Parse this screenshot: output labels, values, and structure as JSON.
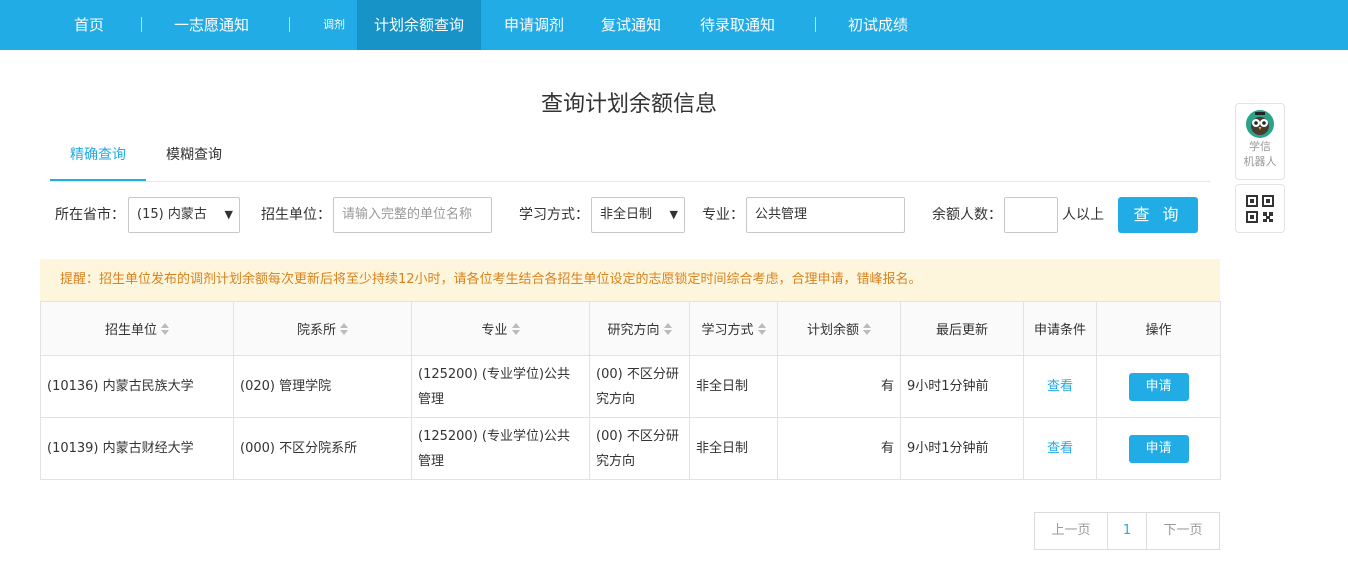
{
  "nav": {
    "items": [
      {
        "label": "首页"
      },
      {
        "label": "一志愿通知"
      },
      {
        "label": "调剂"
      },
      {
        "label": "计划余额查询"
      },
      {
        "label": "申请调剂"
      },
      {
        "label": "复试通知"
      },
      {
        "label": "待录取通知"
      },
      {
        "label": "初试成绩"
      }
    ],
    "active_color": "#1893c7",
    "bar_color": "#22ace5"
  },
  "page_title": "查询计划余额信息",
  "tabs": [
    {
      "label": "精确查询"
    },
    {
      "label": "模糊查询"
    }
  ],
  "filters": {
    "province_label": "所在省市：",
    "province_value": "(15) 内蒙古",
    "unit_label": "招生单位：",
    "unit_placeholder": "请输入完整的单位名称",
    "mode_label": "学习方式：",
    "mode_value": "非全日制",
    "major_label": "专业：",
    "major_value": "公共管理",
    "remain_label": "余额人数：",
    "remain_value": "",
    "remain_suffix": "人以上",
    "query_button": "查 询"
  },
  "notice": "提醒：招生单位发布的调剂计划余额每次更新后将至少持续12小时，请各位考生结合各招生单位设定的志愿锁定时间综合考虑，合理申请，错峰报名。",
  "table": {
    "headers": [
      "招生单位",
      "院系所",
      "专业",
      "研究方向",
      "学习方式",
      "计划余额",
      "最后更新",
      "申请条件",
      "操作"
    ],
    "rows": [
      {
        "unit": "(10136) 内蒙古民族大学",
        "dept": "(020) 管理学院",
        "major": "(125200) (专业学位)公共管理",
        "direction": "(00) 不区分研究方向",
        "mode": "非全日制",
        "remain": "有",
        "updated": "9小时1分钟前",
        "condition": "查看",
        "action": "申请"
      },
      {
        "unit": "(10139) 内蒙古财经大学",
        "dept": "(000) 不区分院系所",
        "major": "(125200) (专业学位)公共管理",
        "direction": "(00) 不区分研究方向",
        "mode": "非全日制",
        "remain": "有",
        "updated": "9小时1分钟前",
        "condition": "查看",
        "action": "申请"
      }
    ]
  },
  "pagination": {
    "prev": "上一页",
    "page": "1",
    "next": "下一页"
  },
  "side": {
    "robot_line1": "学信",
    "robot_line2": "机器人"
  }
}
